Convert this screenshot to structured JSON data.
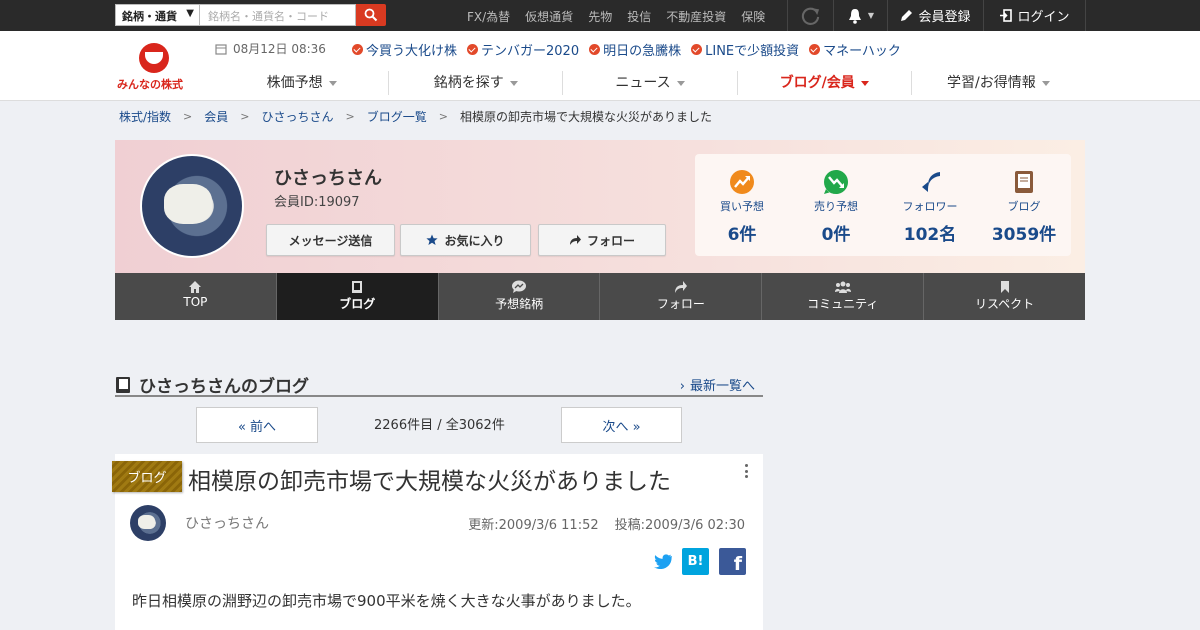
{
  "topbar": {
    "select_label": "銘柄・通貨",
    "search_placeholder": "銘柄名・通貨名・コード",
    "nav": [
      "FX/為替",
      "仮想通貨",
      "先物",
      "投信",
      "不動産投資",
      "保険"
    ],
    "register": "会員登録",
    "login": "ログイン"
  },
  "header": {
    "logo_text": "みんなの株式",
    "date": "08月12日 08:36",
    "links": [
      "今買う大化け株",
      "テンバガー2020",
      "明日の急騰株",
      "LINEで少額投資",
      "マネーハック"
    ],
    "nav": [
      "株価予想",
      "銘柄を探す",
      "ニュース",
      "ブログ/会員",
      "学習/お得情報"
    ],
    "active_nav": "ブログ/会員",
    "accent": "#d9261c"
  },
  "breadcrumb": [
    "株式/指数",
    "会員",
    "ひさっちさん",
    "ブログ一覧",
    "相模原の卸売市場で大規模な火災がありました"
  ],
  "profile": {
    "name": "ひさっちさん",
    "member_id": "会員ID:19097",
    "buttons": [
      "メッセージ送信",
      "お気に入り",
      "フォロー"
    ],
    "stats": [
      {
        "label": "買い予想",
        "value": "6件",
        "icon": "trend-up-icon",
        "color": "#f08a1c"
      },
      {
        "label": "売り予想",
        "value": "0件",
        "icon": "trend-down-icon",
        "color": "#22a84a"
      },
      {
        "label": "フォロワー",
        "value": "102名",
        "icon": "follower-icon",
        "color": "#1a4a8a"
      },
      {
        "label": "ブログ",
        "value": "3059件",
        "icon": "book-icon",
        "color": "#8a5a3a"
      }
    ]
  },
  "tabs": [
    "TOP",
    "ブログ",
    "予想銘柄",
    "フォロー",
    "コミュニティ",
    "リスペクト"
  ],
  "active_tab": "ブログ",
  "blog": {
    "section_title": "ひさっちさんのブログ",
    "more_link": "最新一覧へ",
    "prev": "« 前へ",
    "next": "次へ »",
    "pager_info": "2266件目 / 全3062件",
    "post": {
      "tag": "ブログ",
      "title": "相模原の卸売市場で大規模な火災がありました",
      "author": "ひさっちさん",
      "updated": "更新:2009/3/6 11:52",
      "posted": "投稿:2009/3/6 02:30",
      "hatena": "B!",
      "facebook": "f",
      "body": "昨日相模原の淵野辺の卸売市場で900平米を焼く大きな火事がありました。"
    }
  }
}
